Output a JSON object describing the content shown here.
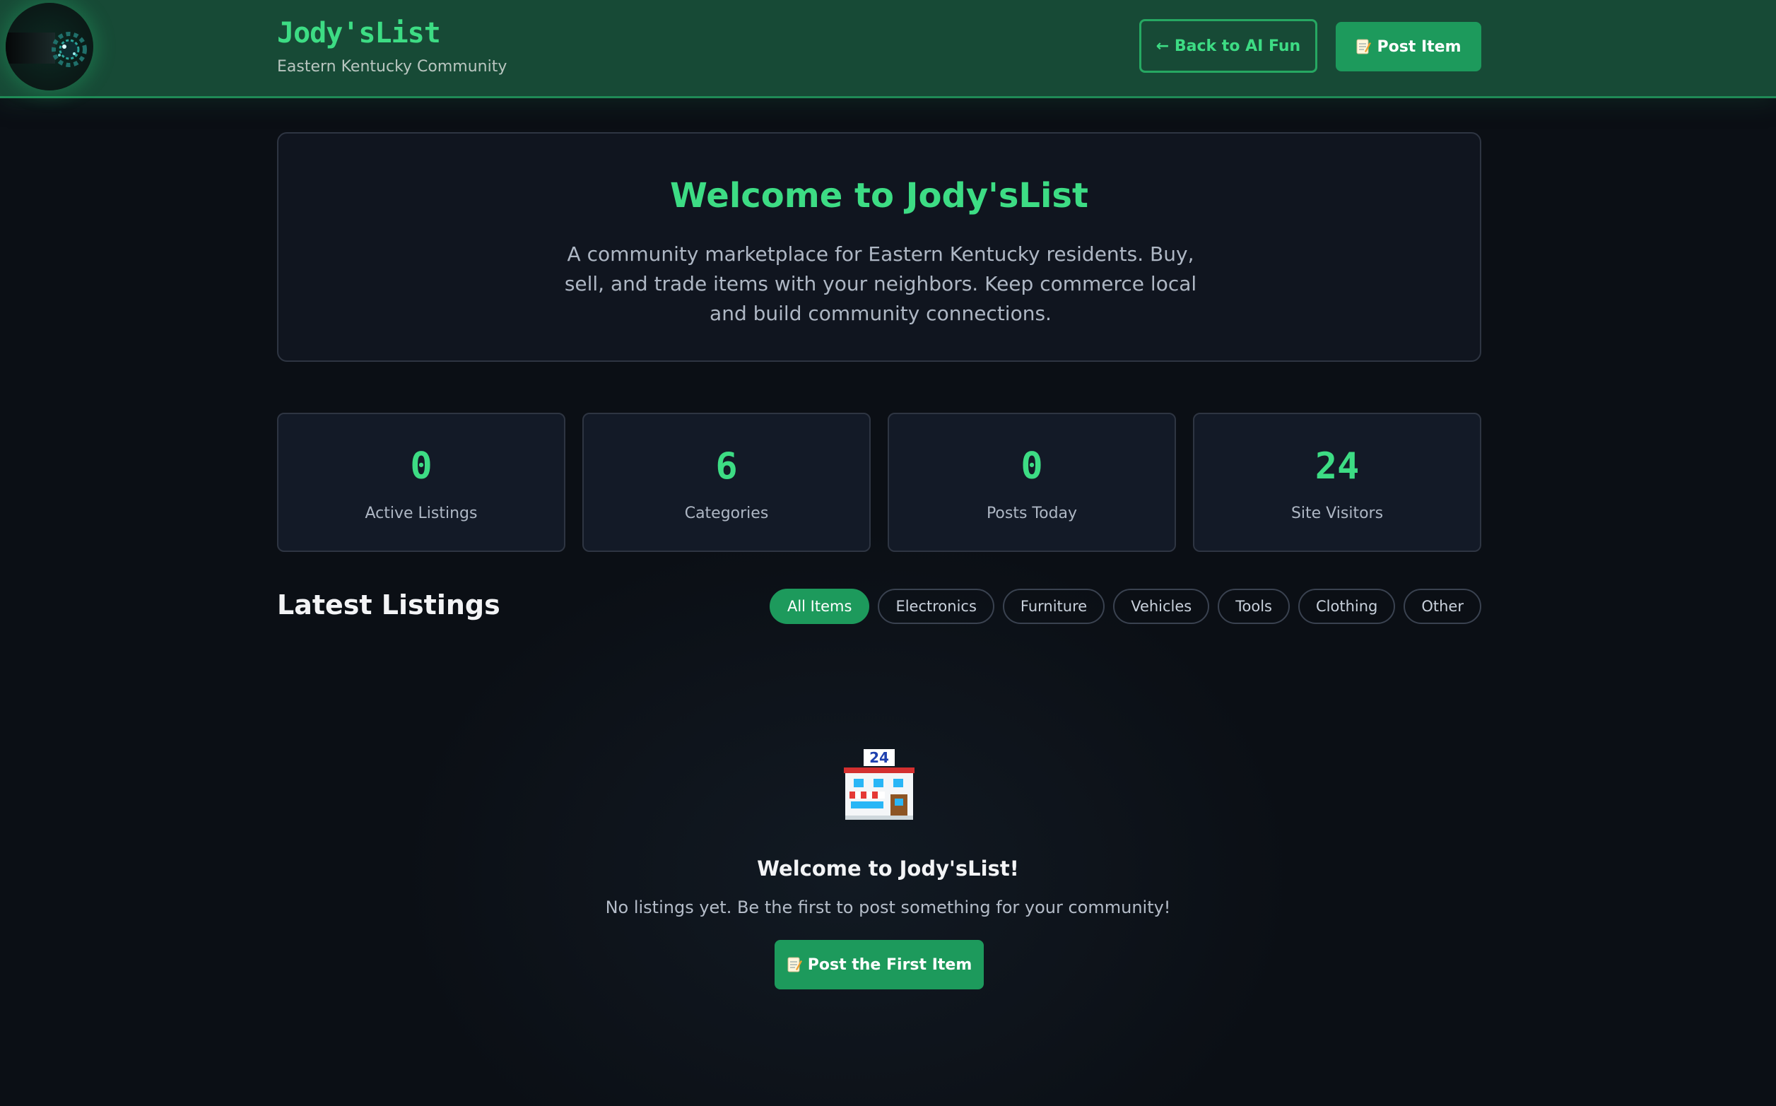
{
  "header": {
    "brand_title": "Jody'sList",
    "brand_subtitle": "Eastern Kentucky Community",
    "back_button": "← Back to AI Fun",
    "post_button": "Post Item",
    "post_icon": "memo-icon"
  },
  "hero": {
    "title": "Welcome to Jody'sList",
    "description": "A community marketplace for Eastern Kentucky residents. Buy, sell, and trade items with your neighbors. Keep commerce local and build community connections."
  },
  "stats": [
    {
      "value": "0",
      "label": "Active Listings"
    },
    {
      "value": "6",
      "label": "Categories"
    },
    {
      "value": "0",
      "label": "Posts Today"
    },
    {
      "value": "24",
      "label": "Site Visitors"
    }
  ],
  "listings": {
    "title": "Latest Listings",
    "filters": [
      "All Items",
      "Electronics",
      "Furniture",
      "Vehicles",
      "Tools",
      "Clothing",
      "Other"
    ],
    "active_filter": "All Items"
  },
  "empty_state": {
    "icon": "convenience-store-icon",
    "icon_sign": "24",
    "title": "Welcome to Jody'sList!",
    "description": "No listings yet. Be the first to post something for your community!",
    "button": "Post the First Item"
  },
  "colors": {
    "accent": "#3ddc84",
    "button_green": "#1d9a5c",
    "header_bg": "#174a36",
    "page_bg": "#0b0f15",
    "card_bg": "#131a27"
  }
}
